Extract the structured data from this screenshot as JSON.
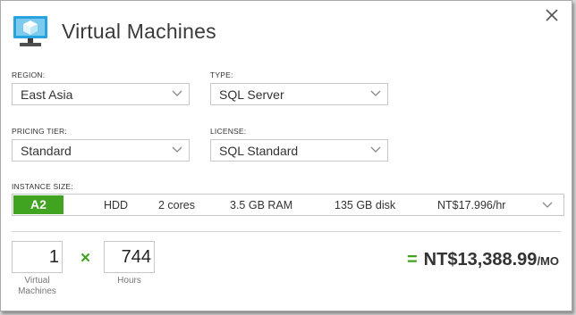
{
  "header": {
    "title": "Virtual Machines",
    "icon": "virtual-machine-icon"
  },
  "region": {
    "label": "REGION:",
    "value": "East Asia"
  },
  "type": {
    "label": "TYPE:",
    "value": "SQL Server"
  },
  "pricing_tier": {
    "label": "PRICING TIER:",
    "value": "Standard"
  },
  "license": {
    "label": "LICENSE:",
    "value": "SQL Standard"
  },
  "instance_size": {
    "label": "INSTANCE SIZE:",
    "tier": "A2",
    "storage": "HDD",
    "cores": "2 cores",
    "ram": "3.5 GB RAM",
    "disk": "135 GB disk",
    "price": "NT$17.996/hr"
  },
  "calc": {
    "vm_count": "1",
    "vm_label_line1": "Virtual",
    "vm_label_line2": "Machines",
    "times": "×",
    "hours": "744",
    "hours_label": "Hours",
    "equals": "=",
    "total": "NT$13,388.99",
    "total_unit": "/MO"
  },
  "colors": {
    "accent": "#41a420",
    "icon_blue": "#27a4dd"
  }
}
